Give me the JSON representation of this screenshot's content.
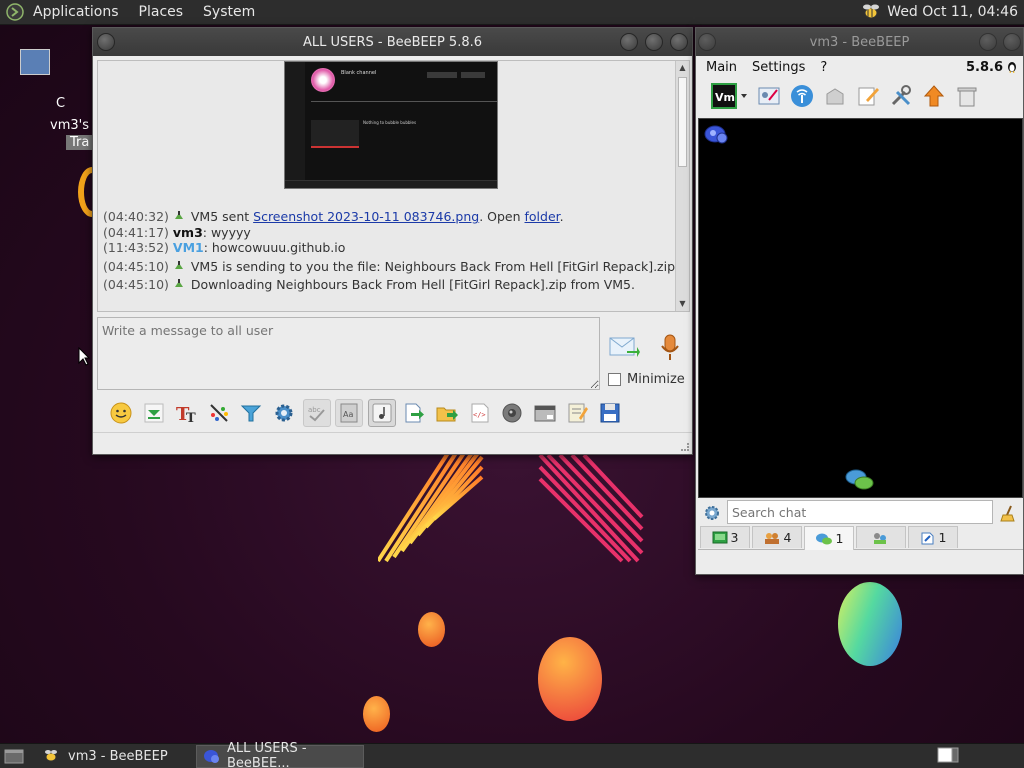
{
  "top_panel": {
    "menu": [
      "Applications",
      "Places",
      "System"
    ],
    "clock": "Wed Oct 11, 04:46"
  },
  "desktop": {
    "icon_label_1": "C",
    "icon_label_2": "vm3's h",
    "icon_label_3": "Tra"
  },
  "chat_window": {
    "title": "ALL USERS - BeeBEEP 5.8.6",
    "messages": [
      {
        "time": "(04:40:32)",
        "pre": " VM5 sent ",
        "link": "Screenshot 2023-10-11 083746.png",
        "mid": ". Open ",
        "link2": "folder",
        "post": "."
      },
      {
        "time": "(04:41:17)",
        "user": "vm3",
        "text": ": wyyyy"
      },
      {
        "time": "(11:43:52)",
        "user": "VM1",
        "text": ": howcowuuu.github.io"
      },
      {
        "time": "(04:45:10)",
        "text": " VM5 is sending to you the file: Neighbours Back From Hell [FitGirl Repack].zip"
      },
      {
        "time": "(04:45:10)",
        "text": " Downloading Neighbours Back From Hell [FitGirl Repack].zip from VM5."
      }
    ],
    "input_placeholder": "Write a message to all user",
    "minimize_label": "Minimize",
    "preview": {
      "channel_title": "Blank channel",
      "video_title": "Nothing to bubble bubbles"
    }
  },
  "side_window": {
    "title": "vm3 - BeeBEEP",
    "menu": [
      "Main",
      "Settings",
      "?"
    ],
    "version": "5.8.6",
    "search_placeholder": "Search chat",
    "tabs": [
      {
        "icon": "users-online-icon",
        "count": "3"
      },
      {
        "icon": "group-icon",
        "count": "4"
      },
      {
        "icon": "chats-icon",
        "count": "1"
      },
      {
        "icon": "groups-icon",
        "count": ""
      },
      {
        "icon": "file-share-icon",
        "count": "1"
      }
    ]
  },
  "taskbar": {
    "tasks": [
      "vm3 - BeeBEEP",
      "ALL USERS - BeeBEE..."
    ]
  }
}
